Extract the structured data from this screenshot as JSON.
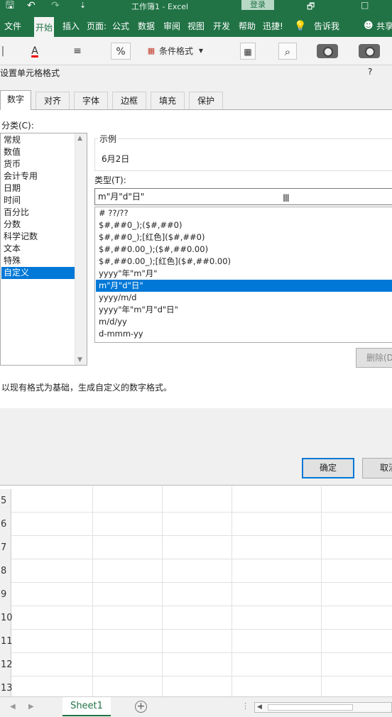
{
  "titlebar": {
    "save_glyph": "🖫",
    "undo_glyph": "↶",
    "redo_glyph": "↷",
    "customize_glyph": "⇣",
    "title": "工作簿1  -  Excel",
    "login": "登录",
    "restore_glyph": "🗗",
    "minimize_glyph": "□"
  },
  "ribbon_tabs": [
    "文件",
    "开始",
    "插入",
    "页面:",
    "公式",
    "数据",
    "审阅",
    "视图",
    "开发",
    "帮助",
    "迅捷!"
  ],
  "tell_me": "告诉我",
  "share": "共享",
  "toolbar": {
    "font_color_glyph": "A",
    "align_glyph": "≡",
    "percent_glyph": "%",
    "conditional_format": "条件格式",
    "search_glyph": "⌕"
  },
  "dialog": {
    "title": "设置单元格格式",
    "help": "?",
    "tabs": [
      "数字",
      "对齐",
      "字体",
      "边框",
      "填充",
      "保护"
    ],
    "category_label": "分类(C):",
    "categories": [
      "常规",
      "数值",
      "货币",
      "会计专用",
      "日期",
      "时间",
      "百分比",
      "分数",
      "科学记数",
      "文本",
      "特殊",
      "自定义"
    ],
    "sample_label": "示例",
    "sample_value": "6月2日",
    "type_label": "类型(T):",
    "type_value": "m\"月\"d\"日\"",
    "formats": [
      "# ??/??",
      "$#,##0_);($#,##0)",
      "$#,##0_);[红色]($#,##0)",
      "$#,##0.00_);($#,##0.00)",
      "$#,##0.00_);[红色]($#,##0.00)",
      "yyyy\"年\"m\"月\"",
      "m\"月\"d\"日\"",
      "yyyy/m/d",
      "yyyy\"年\"m\"月\"d\"日\"",
      "m/d/yy",
      "d-mmm-yy"
    ],
    "selected_format_index": 6,
    "delete_label": "删除(D",
    "description": "以现有格式为基础，生成自定义的数字格式。",
    "ok_label": "确定",
    "cancel_label": "取消"
  },
  "sheet": {
    "row_numbers": [
      "5",
      "6",
      "7",
      "8",
      "9",
      "10",
      "11",
      "12",
      "13"
    ],
    "tab_name": "Sheet1",
    "add_glyph": "+"
  },
  "colors": {
    "excel_green": "#217346",
    "selection_blue": "#0078d7"
  }
}
